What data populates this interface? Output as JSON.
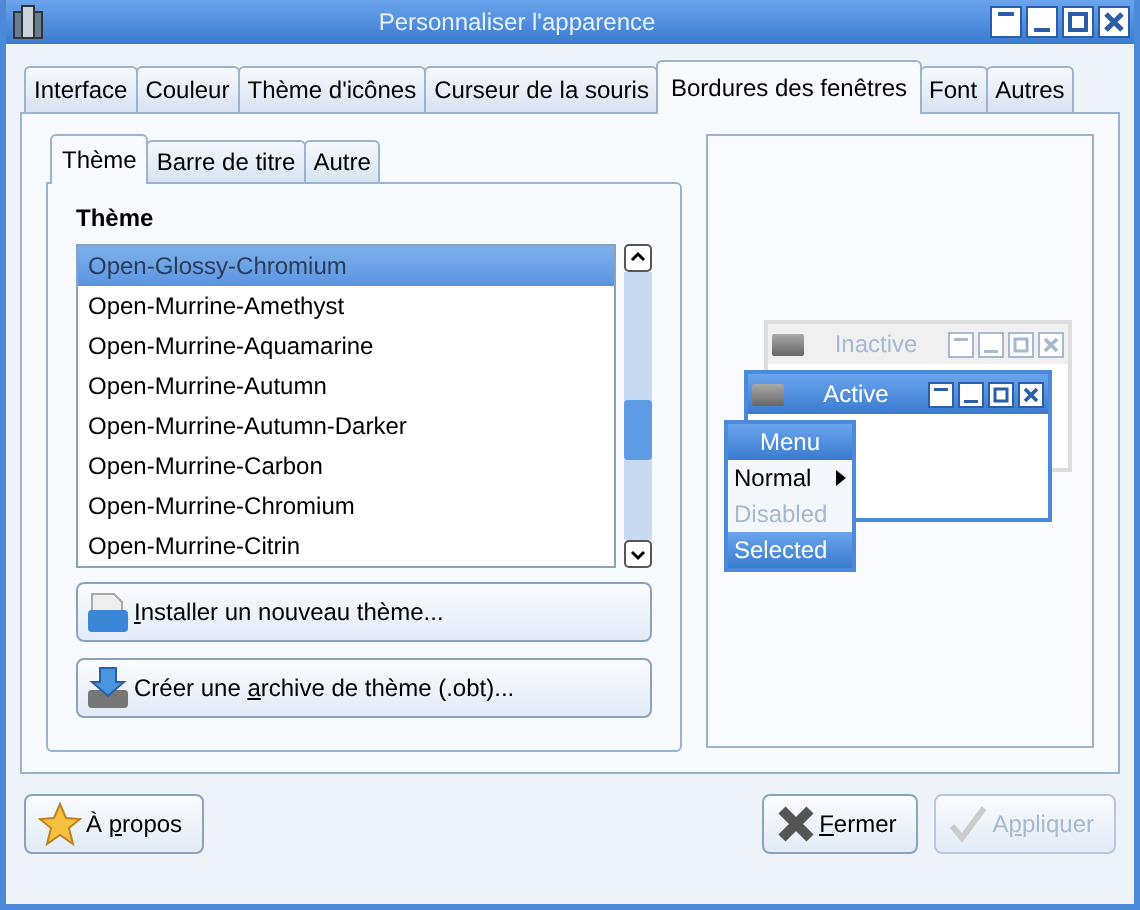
{
  "window": {
    "title": "Personnaliser l'apparence"
  },
  "tabs": [
    {
      "label": "Interface",
      "selected": false
    },
    {
      "label": "Couleur",
      "selected": false
    },
    {
      "label": "Thème d'icônes",
      "selected": false
    },
    {
      "label": "Curseur de la souris",
      "selected": false
    },
    {
      "label": "Bordures des fenêtres",
      "selected": true
    },
    {
      "label": "Font",
      "selected": false
    },
    {
      "label": "Autres",
      "selected": false
    }
  ],
  "subtabs": [
    {
      "label": "Thème",
      "selected": true
    },
    {
      "label": "Barre de titre",
      "selected": false
    },
    {
      "label": "Autre",
      "selected": false
    }
  ],
  "theme_list": {
    "heading": "Thème",
    "items": [
      {
        "label": "Open-Glossy-Chromium",
        "selected": true
      },
      {
        "label": "Open-Murrine-Amethyst",
        "selected": false
      },
      {
        "label": "Open-Murrine-Aquamarine",
        "selected": false
      },
      {
        "label": "Open-Murrine-Autumn",
        "selected": false
      },
      {
        "label": "Open-Murrine-Autumn-Darker",
        "selected": false
      },
      {
        "label": "Open-Murrine-Carbon",
        "selected": false
      },
      {
        "label": "Open-Murrine-Chromium",
        "selected": false
      },
      {
        "label": "Open-Murrine-Citrin",
        "selected": false
      }
    ]
  },
  "theme_buttons": [
    {
      "kind": "install",
      "label": {
        "key": "I",
        "post": "nstaller un nouveau thème..."
      }
    },
    {
      "kind": "archive",
      "label": {
        "pre": "Créer une ",
        "key": "a",
        "post": "rchive de thème (.obt)..."
      }
    }
  ],
  "preview": {
    "inactive_title": "Inactive",
    "active_title": "Active",
    "menu": {
      "title": "Menu",
      "items": [
        {
          "label": "Normal",
          "submenu": true,
          "disabled": false,
          "selected": false
        },
        {
          "label": "Disabled",
          "submenu": false,
          "disabled": true,
          "selected": false
        },
        {
          "label": "Selected",
          "submenu": false,
          "disabled": false,
          "selected": true
        }
      ]
    }
  },
  "footer": [
    {
      "kind": "about",
      "label": {
        "pre": "À ",
        "key": "p",
        "post": "ropos"
      },
      "disabled": false
    },
    {
      "kind": "close",
      "label": {
        "key": "F",
        "post": "ermer"
      },
      "disabled": false
    },
    {
      "kind": "apply",
      "label": {
        "pre": "A",
        "key": "p",
        "post": "pliquer"
      },
      "disabled": true
    }
  ]
}
